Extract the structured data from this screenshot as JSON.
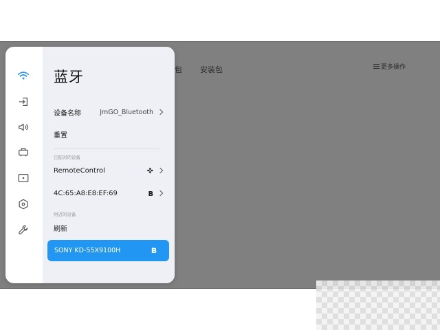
{
  "background": {
    "tabs": [
      "包",
      "安装包"
    ],
    "more_label": "更多操作"
  },
  "panel": {
    "title": "蓝牙",
    "rail_icons": [
      "wifi-icon",
      "input-source-icon",
      "volume-icon",
      "projector-icon",
      "display-icon",
      "settings-icon",
      "wrench-icon"
    ],
    "device_name": {
      "label": "设备名称",
      "value": "JmGO_Bluetooth"
    },
    "reset": {
      "label": "重置"
    },
    "paired_section": "已配对的设备",
    "paired_devices": [
      {
        "name": "RemoteControl",
        "icon": "gamepad-icon"
      },
      {
        "name": "4C:65:A8:E8:EF:69",
        "icon": "bluetooth-icon"
      }
    ],
    "nearby_section": "附近的设备",
    "refresh": {
      "label": "刷新"
    },
    "nearby_devices": [
      {
        "name": "SONY KD-55X9100H",
        "icon": "bluetooth-icon",
        "selected": true
      }
    ],
    "accent_color": "#2196f3"
  }
}
